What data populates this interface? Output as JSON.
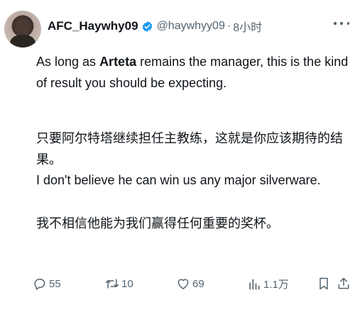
{
  "tweet": {
    "author_name": "AFC_Haywhy09",
    "handle": "@haywhyy09",
    "separator": "·",
    "time": "8小时",
    "p1_before": "As long as ",
    "p1_bold": "Arteta",
    "p1_after": " remains the manager, this is the kind of result you should be expecting.",
    "p2": "只要阿尔特塔继续担任主教练，这就是你应该期待的结果。",
    "p3": "I don't believe he can win us any major silverware.",
    "p4": "我不相信他能为我们赢得任何重要的奖杯。"
  },
  "actions": {
    "replies": "55",
    "reposts": "10",
    "likes": "69",
    "views": "1.1万"
  },
  "icons": {
    "verified": "verified-badge-icon",
    "more": "more-options-icon",
    "reply": "reply-icon",
    "repost": "repost-icon",
    "like": "heart-icon",
    "views": "analytics-icon",
    "bookmark": "bookmark-icon",
    "share": "share-icon"
  },
  "colors": {
    "verified": "#1d9bf0",
    "muted": "#536471",
    "text": "#0f1419"
  }
}
